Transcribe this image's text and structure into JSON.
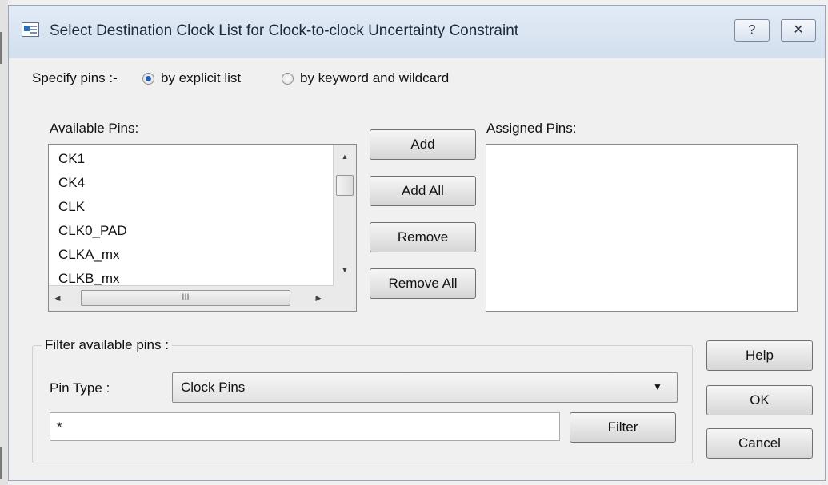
{
  "window": {
    "title": "Select Destination Clock List for Clock-to-clock Uncertainty Constraint",
    "help_glyph": "?",
    "close_glyph": "✕"
  },
  "specify": {
    "label": "Specify pins :-",
    "options": [
      {
        "label": "by explicit list",
        "selected": true
      },
      {
        "label": "by keyword and wildcard",
        "selected": false
      }
    ]
  },
  "available": {
    "label": "Available Pins:",
    "items": [
      "CK1",
      "CK4",
      "CLK",
      "CLK0_PAD",
      "CLKA_mx",
      "CLKB_mx"
    ]
  },
  "assigned": {
    "label": "Assigned Pins:",
    "items": []
  },
  "actions": {
    "add": "Add",
    "add_all": "Add All",
    "remove": "Remove",
    "remove_all": "Remove All"
  },
  "filter": {
    "group_label": "Filter available pins :",
    "pin_type_label": "Pin Type :",
    "pin_type_value": "Clock Pins",
    "pattern_value": "*",
    "filter_button": "Filter"
  },
  "dialog_buttons": {
    "help": "Help",
    "ok": "OK",
    "cancel": "Cancel"
  },
  "icons": {
    "scroll_up": "▲",
    "scroll_down": "▼",
    "scroll_left": "◀",
    "scroll_right": "▶",
    "combo_arrow": "▼",
    "grip": "III"
  }
}
